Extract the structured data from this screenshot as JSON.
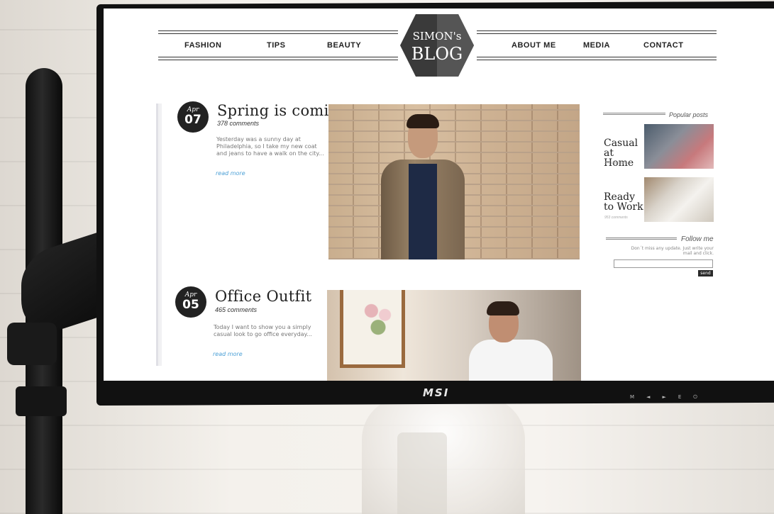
{
  "nav": {
    "left": [
      "FASHION",
      "TIPS",
      "BEAUTY"
    ],
    "right": [
      "ABOUT ME",
      "MEDIA",
      "CONTACT"
    ]
  },
  "logo": {
    "line1": "SIMON's",
    "line2": "BLOG"
  },
  "posts": [
    {
      "month": "Apr",
      "day": "07",
      "title": "Spring is coming!",
      "comments": "378 comments",
      "excerpt": "Yesterday was a sunny day at Philadelphia, so I take my new coat and jeans to have a walk on the city...",
      "read_more": "read more"
    },
    {
      "month": "Apr",
      "day": "05",
      "title": "Office Outfit",
      "comments": "465 comments",
      "excerpt": "Today I want to show you a simply casual look to go office everyday...",
      "read_more": "read more"
    }
  ],
  "sidebar": {
    "popular_heading": "Popular posts",
    "popular": [
      {
        "title_line1": "Casual",
        "title_line2": "at Home",
        "comments": "378 comments"
      },
      {
        "title_line1": "Ready",
        "title_line2": "to Work",
        "comments": "953 comments"
      }
    ],
    "follow_heading": "Follow me",
    "follow_text": "Don´t miss any update. Just write your mail and click.",
    "send_label": "send"
  },
  "monitor": {
    "brand": "MSI",
    "buttons": [
      "M",
      "◄",
      "►",
      "E",
      "⏻"
    ]
  }
}
